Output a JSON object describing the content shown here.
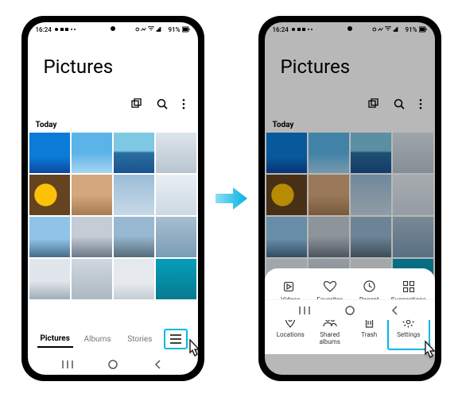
{
  "statusbar": {
    "time": "16:24",
    "battery": "91%"
  },
  "header": {
    "title": "Pictures"
  },
  "section": {
    "today": "Today"
  },
  "tabs": {
    "pictures": "Pictures",
    "albums": "Albums",
    "stories": "Stories"
  },
  "sheet": {
    "videos": "Videos",
    "favorites": "Favorites",
    "recent": "Recent",
    "suggestions": "Suggestions",
    "locations": "Locations",
    "shared": "Shared albums",
    "trash": "Trash",
    "settings": "Settings"
  }
}
